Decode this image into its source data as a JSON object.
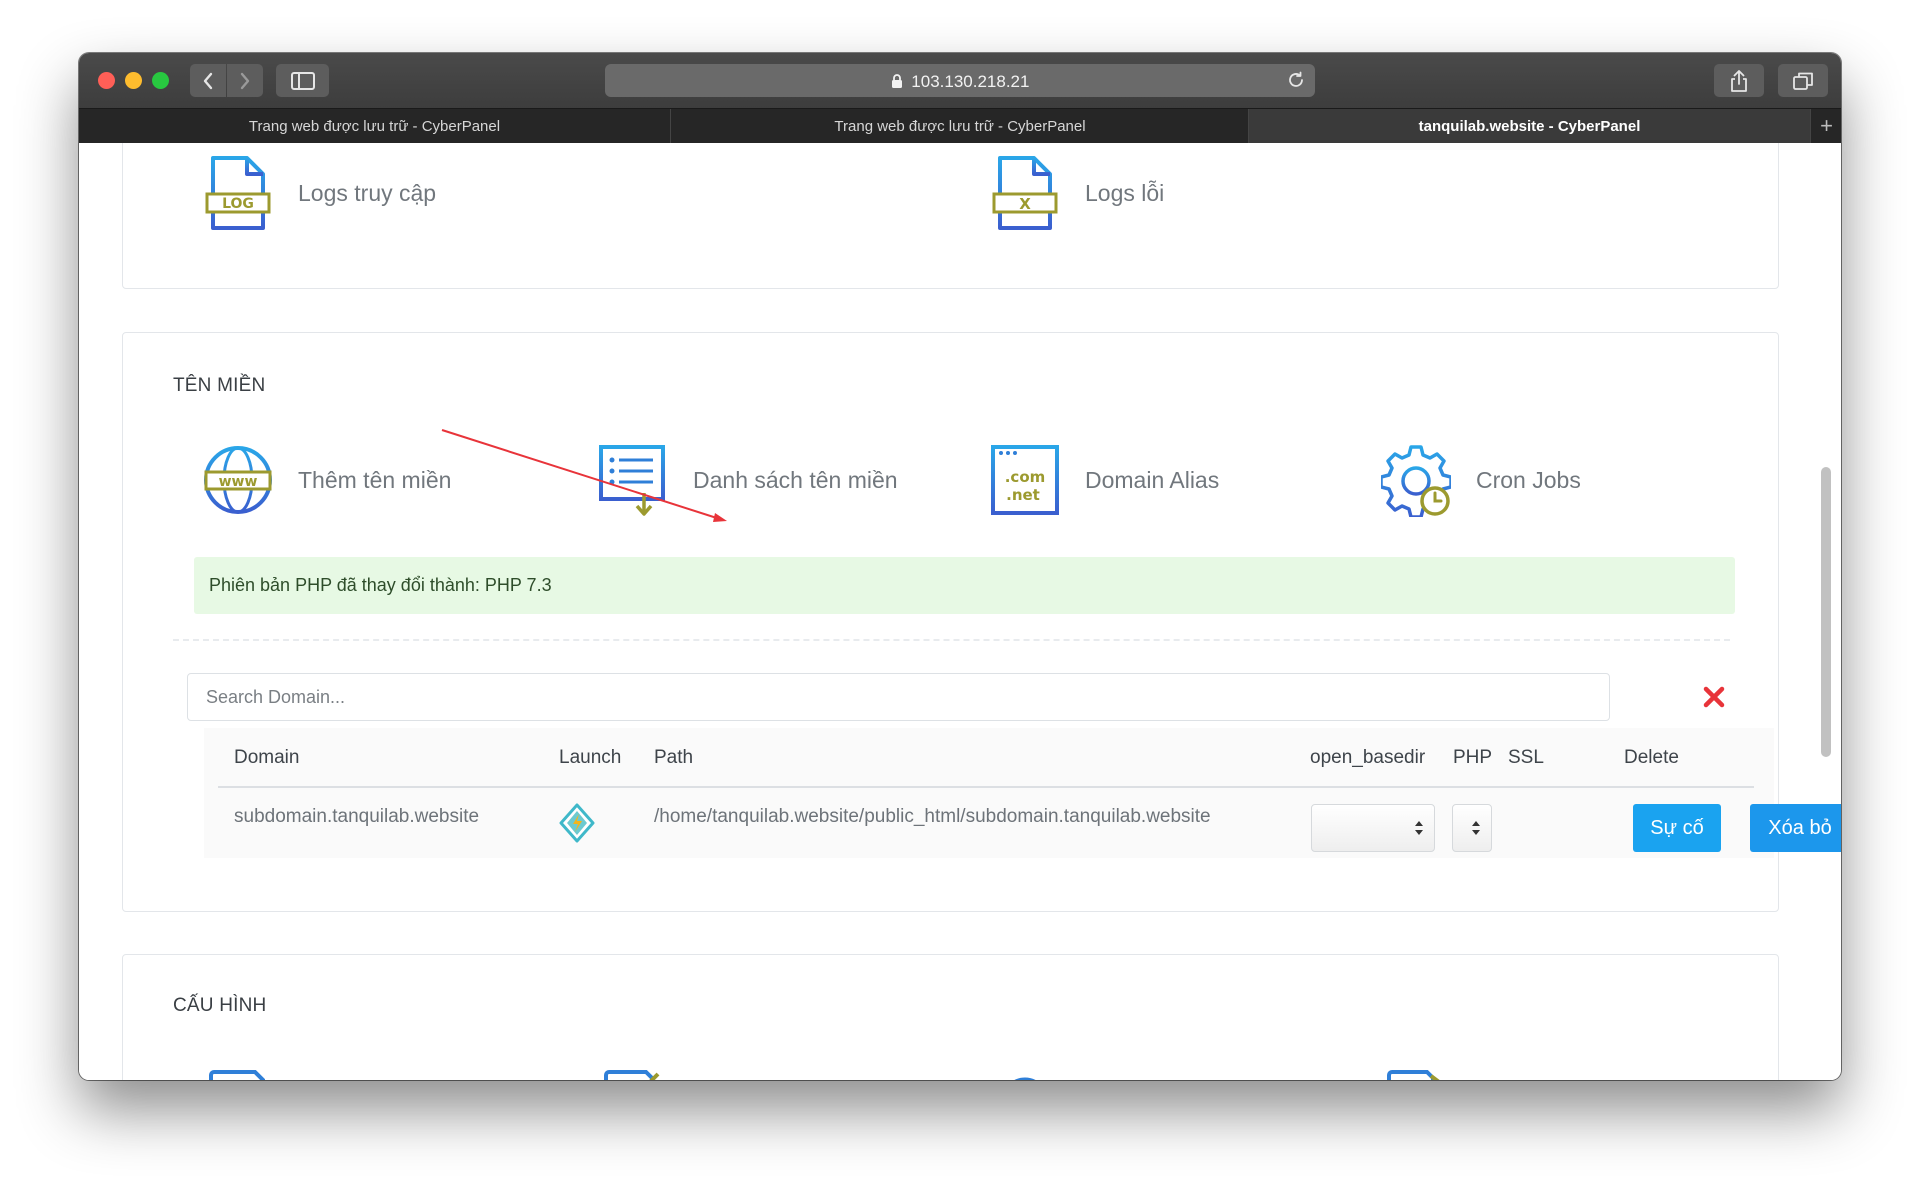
{
  "browser": {
    "address": "103.130.218.21",
    "tabs": [
      {
        "title": "Trang web được lưu trữ - CyberPanel"
      },
      {
        "title": "Trang web được lưu trữ - CyberPanel"
      },
      {
        "title": "tanquilab.website - CyberPanel"
      }
    ],
    "new_tab_symbol": "+"
  },
  "logs": {
    "access_logs_label": "Logs truy cập",
    "error_logs_label": "Logs lỗi",
    "access_icon_text": "LOG",
    "error_icon_text": "X"
  },
  "domains": {
    "section_title": "TÊN MIỀN",
    "tiles": [
      {
        "label": "Thêm tên miền",
        "icon": "www-globe-icon"
      },
      {
        "label": "Danh sách tên miền",
        "icon": "list-download-icon"
      },
      {
        "label": "Domain Alias",
        "icon": "com-net-icon"
      },
      {
        "label": "Cron Jobs",
        "icon": "gear-clock-icon"
      }
    ],
    "globe_text": "www",
    "alias_text_1": ".com",
    "alias_text_2": ".net",
    "alert": "Phiên bản PHP đã thay đổi thành: PHP 7.3",
    "search_placeholder": "Search Domain...",
    "table": {
      "headers": [
        "Domain",
        "Launch",
        "Path",
        "open_basedir",
        "PHP",
        "SSL",
        "Delete"
      ],
      "rows": [
        {
          "domain": "subdomain.tanquilab.website",
          "path": "/home/tanquilab.website/public_html/subdomain.tanquilab.website",
          "open_basedir": "",
          "php": "",
          "ssl_button": "Sự cố",
          "delete_button": "Xóa bỏ"
        }
      ]
    }
  },
  "config": {
    "section_title": "CẤU HÌNH"
  },
  "colors": {
    "accent_blue": "#1c97ec",
    "icon_blue": "#2f7fd8",
    "icon_olive": "#9c9a2f",
    "alert_bg": "#e7f9e4",
    "clear_red": "#e8343a",
    "annotation_red": "#e8343a"
  }
}
